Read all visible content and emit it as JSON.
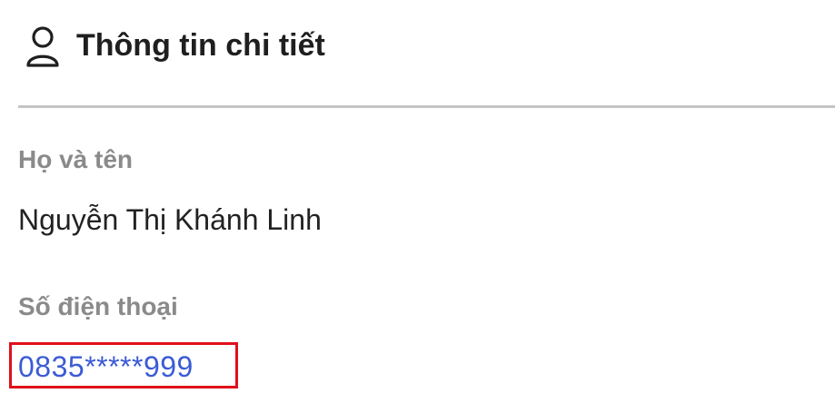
{
  "header": {
    "icon": "user-icon",
    "title": "Thông tin chi tiết"
  },
  "fields": {
    "name": {
      "label": "Họ và tên",
      "value": "Nguyễn Thị Khánh Linh"
    },
    "phone": {
      "label": "Số điện thoại",
      "value": "0835*****999"
    }
  },
  "colors": {
    "title": "#1f1f1f",
    "label": "#8a8a8a",
    "value": "#222222",
    "phone_link": "#3b5bd6",
    "highlight_border": "#e0101a",
    "divider": "#c4c4c4"
  }
}
